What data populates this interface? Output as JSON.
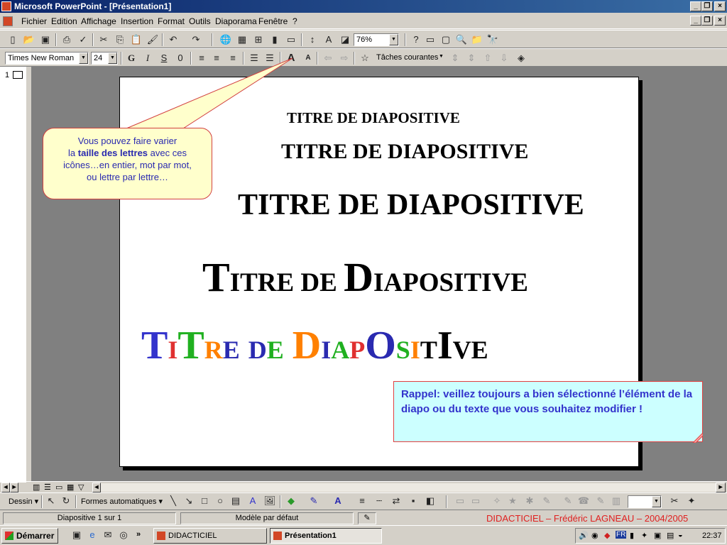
{
  "window": {
    "title": "Microsoft PowerPoint - [Présentation1]"
  },
  "menu": [
    "Fichier",
    "Edition",
    "Affichage",
    "Insertion",
    "Format",
    "Outils",
    "Diaporama",
    "Fenêtre",
    "?"
  ],
  "standard_toolbar": {
    "zoom": "76%"
  },
  "format_toolbar": {
    "font": "Times New Roman",
    "size": "24",
    "bold": "G",
    "italic": "I",
    "shadow": "S",
    "strike": "0",
    "tasks": "Tâches courantes"
  },
  "slide_panel": {
    "slide_number": "1"
  },
  "slide": {
    "titles": [
      "TITRE DE DIAPOSITIVE",
      "TITRE DE DIAPOSITIVE",
      "TITRE DE DIAPOSITIVE"
    ],
    "smallcaps": {
      "big1": "T",
      "rest1": "ITRE DE ",
      "big2": "D",
      "rest2": "IAPOSITIVE"
    },
    "colorful": [
      {
        "ch": "T",
        "color": "#3333cc",
        "big": true
      },
      {
        "ch": "I",
        "color": "#e03030",
        "big": false
      },
      {
        "ch": "T",
        "color": "#20b020",
        "big": true
      },
      {
        "ch": "R",
        "color": "#ff8000",
        "big": false
      },
      {
        "ch": "E",
        "color": "#2a2ab0",
        "big": false
      },
      {
        "ch": " ",
        "color": "#000",
        "big": false
      },
      {
        "ch": "D",
        "color": "#2a2ab0",
        "big": false
      },
      {
        "ch": "E",
        "color": "#20b020",
        "big": false
      },
      {
        "ch": " ",
        "color": "#000",
        "big": false
      },
      {
        "ch": "D",
        "color": "#ff8000",
        "big": true
      },
      {
        "ch": "I",
        "color": "#2a2ab0",
        "big": false
      },
      {
        "ch": "A",
        "color": "#20b020",
        "big": false
      },
      {
        "ch": "P",
        "color": "#e03030",
        "big": false
      },
      {
        "ch": "O",
        "color": "#2a2ab0",
        "big": true
      },
      {
        "ch": "S",
        "color": "#20b020",
        "big": false
      },
      {
        "ch": "I",
        "color": "#ff8000",
        "big": false
      },
      {
        "ch": "T",
        "color": "#000",
        "big": false
      },
      {
        "ch": "I",
        "color": "#000",
        "big": true
      },
      {
        "ch": "V",
        "color": "#000",
        "big": false
      },
      {
        "ch": "E",
        "color": "#000",
        "big": false
      }
    ],
    "callout": {
      "line1": "Vous pouvez faire varier",
      "line2a": "la ",
      "line2b": "taille des lettres",
      "line2c": " avec ces",
      "line3": "icônes…en entier, mot par mot,",
      "line4": "ou lettre par lettre…"
    },
    "rappel": "Rappel: veillez toujours a bien sélectionné l’élément de la diapo ou du texte que vous souhaitez modifier !"
  },
  "drawing_toolbar": {
    "draw": "Dessin",
    "autoshapes": "Formes automatiques"
  },
  "status": {
    "slide": "Diapositive 1 sur 1",
    "design": "Modèle par défaut",
    "credit": "DIDACTICIEL – Frédéric LAGNEAU – 2004/2005"
  },
  "taskbar": {
    "start": "Démarrer",
    "btn1": "DIDACTICIEL",
    "btn2": "Présentation1",
    "clock": "22:37"
  }
}
